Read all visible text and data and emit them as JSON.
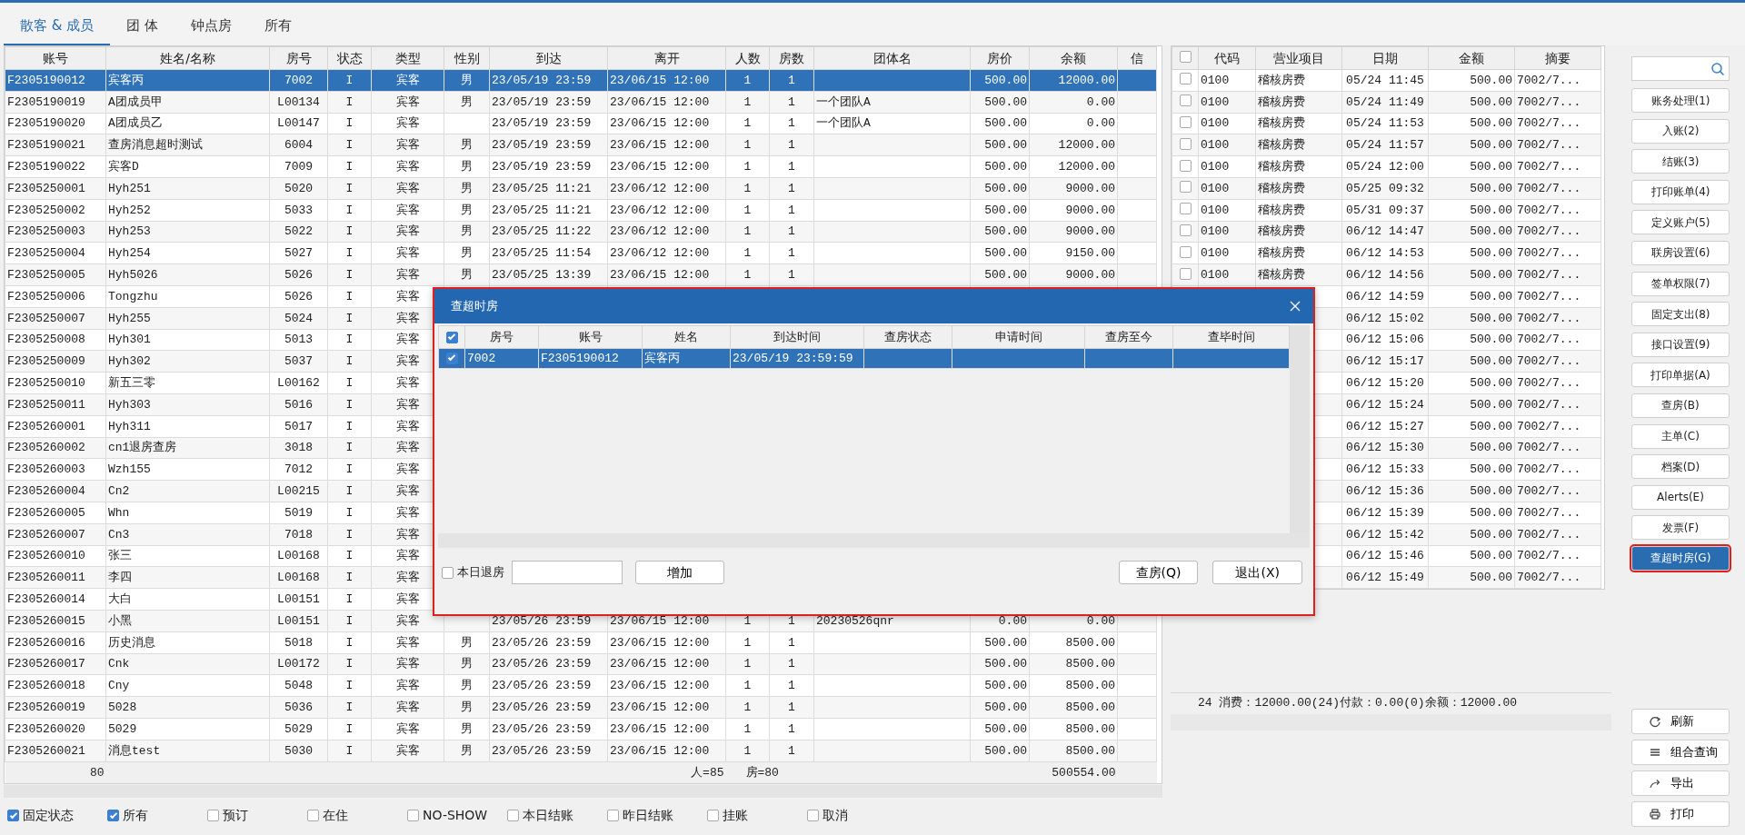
{
  "tabs": [
    {
      "label": "散客 & 成员",
      "selected": true
    },
    {
      "label": "团 体",
      "selected": false
    },
    {
      "label": "钟点房",
      "selected": false
    },
    {
      "label": "所有",
      "selected": false
    }
  ],
  "guest_table": {
    "columns": [
      "账号",
      "姓名/名称",
      "房号",
      "状态",
      "类型",
      "性别",
      "到达",
      "离开",
      "人数",
      "房数",
      "团体名",
      "房价",
      "余额",
      "信"
    ],
    "rows": [
      {
        "selected": true,
        "account": "F2305190012",
        "name": "宾客丙",
        "room": "7002",
        "status": "I",
        "type": "宾客",
        "sex": "男",
        "arrive": "23/05/19 23:59",
        "depart": "23/06/15 12:00",
        "people": "1",
        "rooms": "1",
        "rate": "500.00",
        "balance": "12000.00"
      },
      {
        "selected": false,
        "account": "F2305190019",
        "name": "A团成员甲",
        "room": "L00134",
        "status": "I",
        "type": "宾客",
        "sex": "男",
        "arrive": "23/05/19 23:59",
        "depart": "23/06/15 12:00",
        "people": "1",
        "rooms": "1",
        "group": "一个团队A",
        "rate": "500.00",
        "balance": "0.00"
      },
      {
        "selected": false,
        "account": "F2305190020",
        "name": "A团成员乙",
        "room": "L00147",
        "status": "I",
        "type": "宾客",
        "arrive": "23/05/19 23:59",
        "depart": "23/06/15 12:00",
        "people": "1",
        "rooms": "1",
        "group": "一个团队A",
        "rate": "500.00",
        "balance": "0.00"
      },
      {
        "selected": false,
        "account": "F2305190021",
        "name": "查房消息超时测试",
        "room": "6004",
        "status": "I",
        "type": "宾客",
        "sex": "男",
        "arrive": "23/05/19 23:59",
        "depart": "23/06/15 12:00",
        "people": "1",
        "rooms": "1",
        "rate": "500.00",
        "balance": "12000.00"
      },
      {
        "selected": false,
        "account": "F2305190022",
        "name": "宾客D",
        "room": "7009",
        "status": "I",
        "type": "宾客",
        "sex": "男",
        "arrive": "23/05/19 23:59",
        "depart": "23/06/15 12:00",
        "people": "1",
        "rooms": "1",
        "rate": "500.00",
        "balance": "12000.00"
      },
      {
        "selected": false,
        "account": "F2305250001",
        "name": "Hyh251",
        "room": "5020",
        "status": "I",
        "type": "宾客",
        "sex": "男",
        "arrive": "23/05/25 11:21",
        "depart": "23/06/12 12:00",
        "people": "1",
        "rooms": "1",
        "rate": "500.00",
        "balance": "9000.00"
      },
      {
        "selected": false,
        "account": "F2305250002",
        "name": "Hyh252",
        "room": "5033",
        "status": "I",
        "type": "宾客",
        "sex": "男",
        "arrive": "23/05/25 11:21",
        "depart": "23/06/12 12:00",
        "people": "1",
        "rooms": "1",
        "rate": "500.00",
        "balance": "9000.00"
      },
      {
        "selected": false,
        "account": "F2305250003",
        "name": "Hyh253",
        "room": "5022",
        "status": "I",
        "type": "宾客",
        "sex": "男",
        "arrive": "23/05/25 11:22",
        "depart": "23/06/12 12:00",
        "people": "1",
        "rooms": "1",
        "rate": "500.00",
        "balance": "9000.00"
      },
      {
        "selected": false,
        "account": "F2305250004",
        "name": "Hyh254",
        "room": "5027",
        "status": "I",
        "type": "宾客",
        "sex": "男",
        "arrive": "23/05/25 11:54",
        "depart": "23/06/12 12:00",
        "people": "1",
        "rooms": "1",
        "rate": "500.00",
        "balance": "9150.00"
      },
      {
        "selected": false,
        "account": "F2305250005",
        "name": "Hyh5026",
        "room": "5026",
        "status": "I",
        "type": "宾客",
        "sex": "男",
        "arrive": "23/05/25 13:39",
        "depart": "23/06/15 12:00",
        "people": "1",
        "rooms": "1",
        "rate": "500.00",
        "balance": "9000.00"
      },
      {
        "selected": false,
        "account": "F2305250006",
        "name": "Tongzhu",
        "room": "5026",
        "status": "I",
        "type": "宾客"
      },
      {
        "selected": false,
        "account": "F2305250007",
        "name": "Hyh255",
        "room": "5024",
        "status": "I",
        "type": "宾客"
      },
      {
        "selected": false,
        "account": "F2305250008",
        "name": "Hyh301",
        "room": "5013",
        "status": "I",
        "type": "宾客"
      },
      {
        "selected": false,
        "account": "F2305250009",
        "name": "Hyh302",
        "room": "5037",
        "status": "I",
        "type": "宾客"
      },
      {
        "selected": false,
        "account": "F2305250010",
        "name": "新五三零",
        "room": "L00162",
        "status": "I",
        "type": "宾客"
      },
      {
        "selected": false,
        "account": "F2305250011",
        "name": "Hyh303",
        "room": "5016",
        "status": "I",
        "type": "宾客"
      },
      {
        "selected": false,
        "account": "F2305260001",
        "name": "Hyh311",
        "room": "5017",
        "status": "I",
        "type": "宾客"
      },
      {
        "selected": false,
        "account": "F2305260002",
        "name": "cn1退房查房",
        "room": "3018",
        "status": "I",
        "type": "宾客"
      },
      {
        "selected": false,
        "account": "F2305260003",
        "name": "Wzh155",
        "room": "7012",
        "status": "I",
        "type": "宾客"
      },
      {
        "selected": false,
        "account": "F2305260004",
        "name": "Cn2",
        "room": "L00215",
        "status": "I",
        "type": "宾客"
      },
      {
        "selected": false,
        "account": "F2305260005",
        "name": "Whn",
        "room": "5019",
        "status": "I",
        "type": "宾客"
      },
      {
        "selected": false,
        "account": "F2305260007",
        "name": "Cn3",
        "room": "7018",
        "status": "I",
        "type": "宾客"
      },
      {
        "selected": false,
        "account": "F2305260010",
        "name": "张三",
        "room": "L00168",
        "status": "I",
        "type": "宾客"
      },
      {
        "selected": false,
        "account": "F2305260011",
        "name": "李四",
        "room": "L00168",
        "status": "I",
        "type": "宾客"
      },
      {
        "selected": false,
        "account": "F2305260014",
        "name": "大白",
        "room": "L00151",
        "status": "I",
        "type": "宾客"
      },
      {
        "selected": false,
        "account": "F2305260015",
        "name": "小黑",
        "room": "L00151",
        "status": "I",
        "type": "宾客",
        "arrive": "23/05/26 23:59",
        "depart": "23/06/15 12:00",
        "people": "1",
        "rooms": "1",
        "group": "20230526qnr",
        "rate": "0.00",
        "balance": "0.00"
      },
      {
        "selected": false,
        "account": "F2305260016",
        "name": "历史消息",
        "room": "5018",
        "status": "I",
        "type": "宾客",
        "sex": "男",
        "arrive": "23/05/26 23:59",
        "depart": "23/06/15 12:00",
        "people": "1",
        "rooms": "1",
        "rate": "500.00",
        "balance": "8500.00"
      },
      {
        "selected": false,
        "account": "F2305260017",
        "name": "Cnk",
        "room": "L00172",
        "status": "I",
        "type": "宾客",
        "sex": "男",
        "arrive": "23/05/26 23:59",
        "depart": "23/06/15 12:00",
        "people": "1",
        "rooms": "1",
        "rate": "500.00",
        "balance": "8500.00"
      },
      {
        "selected": false,
        "account": "F2305260018",
        "name": "Cny",
        "room": "5048",
        "status": "I",
        "type": "宾客",
        "sex": "男",
        "arrive": "23/05/26 23:59",
        "depart": "23/06/15 12:00",
        "people": "1",
        "rooms": "1",
        "rate": "500.00",
        "balance": "8500.00"
      },
      {
        "selected": false,
        "account": "F2305260019",
        "name": "5028",
        "room": "5036",
        "status": "I",
        "type": "宾客",
        "sex": "男",
        "arrive": "23/05/26 23:59",
        "depart": "23/06/15 12:00",
        "people": "1",
        "rooms": "1",
        "rate": "500.00",
        "balance": "8500.00"
      },
      {
        "selected": false,
        "account": "F2305260020",
        "name": "5029",
        "room": "5029",
        "status": "I",
        "type": "宾客",
        "sex": "男",
        "arrive": "23/05/26 23:59",
        "depart": "23/06/15 12:00",
        "people": "1",
        "rooms": "1",
        "rate": "500.00",
        "balance": "8500.00"
      },
      {
        "selected": false,
        "account": "F2305260021",
        "name": "消息test",
        "room": "5030",
        "status": "I",
        "type": "宾客",
        "sex": "男",
        "arrive": "23/05/26 23:59",
        "depart": "23/06/15 12:00",
        "people": "1",
        "rooms": "1",
        "rate": "500.00",
        "balance": "8500.00"
      }
    ],
    "footer": {
      "count": "80",
      "people": "人=85",
      "rooms": "房=80",
      "balance": "500554.00"
    }
  },
  "filters": [
    {
      "label": "固定状态",
      "checked": true
    },
    {
      "label": "所有",
      "checked": true
    },
    {
      "label": "预订",
      "checked": false
    },
    {
      "label": "在住",
      "checked": false
    },
    {
      "label": "NO-SHOW",
      "checked": false
    },
    {
      "label": "本日结账",
      "checked": false
    },
    {
      "label": "昨日结账",
      "checked": false
    },
    {
      "label": "挂账",
      "checked": false
    },
    {
      "label": "取消",
      "checked": false
    }
  ],
  "folio_table": {
    "select_all": {
      "checked": false
    },
    "columns": [
      "代码",
      "营业项目",
      "日期",
      "金额",
      "摘要"
    ],
    "rows": [
      {
        "checked": false,
        "code": "0100",
        "item": "稽核房费",
        "date": "05/24 11:45",
        "amount": "500.00",
        "memo": "7002/7..."
      },
      {
        "checked": false,
        "code": "0100",
        "item": "稽核房费",
        "date": "05/24 11:49",
        "amount": "500.00",
        "memo": "7002/7..."
      },
      {
        "checked": false,
        "code": "0100",
        "item": "稽核房费",
        "date": "05/24 11:53",
        "amount": "500.00",
        "memo": "7002/7..."
      },
      {
        "checked": false,
        "code": "0100",
        "item": "稽核房费",
        "date": "05/24 11:57",
        "amount": "500.00",
        "memo": "7002/7..."
      },
      {
        "checked": false,
        "code": "0100",
        "item": "稽核房费",
        "date": "05/24 12:00",
        "amount": "500.00",
        "memo": "7002/7..."
      },
      {
        "checked": false,
        "code": "0100",
        "item": "稽核房费",
        "date": "05/25 09:32",
        "amount": "500.00",
        "memo": "7002/7..."
      },
      {
        "checked": false,
        "code": "0100",
        "item": "稽核房费",
        "date": "05/31 09:37",
        "amount": "500.00",
        "memo": "7002/7..."
      },
      {
        "checked": false,
        "code": "0100",
        "item": "稽核房费",
        "date": "06/12 14:47",
        "amount": "500.00",
        "memo": "7002/7..."
      },
      {
        "checked": false,
        "code": "0100",
        "item": "稽核房费",
        "date": "06/12 14:53",
        "amount": "500.00",
        "memo": "7002/7..."
      },
      {
        "checked": false,
        "code": "0100",
        "item": "稽核房费",
        "date": "06/12 14:56",
        "amount": "500.00",
        "memo": "7002/7..."
      },
      {
        "date": "06/12 14:59",
        "amount": "500.00",
        "memo": "7002/7..."
      },
      {
        "date": "06/12 15:02",
        "amount": "500.00",
        "memo": "7002/7..."
      },
      {
        "date": "06/12 15:06",
        "amount": "500.00",
        "memo": "7002/7..."
      },
      {
        "date": "06/12 15:17",
        "amount": "500.00",
        "memo": "7002/7..."
      },
      {
        "date": "06/12 15:20",
        "amount": "500.00",
        "memo": "7002/7..."
      },
      {
        "date": "06/12 15:24",
        "amount": "500.00",
        "memo": "7002/7..."
      },
      {
        "date": "06/12 15:27",
        "amount": "500.00",
        "memo": "7002/7..."
      },
      {
        "date": "06/12 15:30",
        "amount": "500.00",
        "memo": "7002/7..."
      },
      {
        "date": "06/12 15:33",
        "amount": "500.00",
        "memo": "7002/7..."
      },
      {
        "date": "06/12 15:36",
        "amount": "500.00",
        "memo": "7002/7..."
      },
      {
        "date": "06/12 15:39",
        "amount": "500.00",
        "memo": "7002/7..."
      },
      {
        "date": "06/12 15:42",
        "amount": "500.00",
        "memo": "7002/7..."
      },
      {
        "date": "06/12 15:46",
        "amount": "500.00",
        "memo": "7002/7..."
      },
      {
        "date": "06/12 15:49",
        "amount": "500.00",
        "memo": "7002/7..."
      }
    ],
    "summary": "24 消费：12000.00(24)付款：0.00(0)余额：12000.00"
  },
  "actions": {
    "buttons": [
      {
        "label": "账务处理(1)",
        "selected": false
      },
      {
        "label": "入账(2)",
        "selected": false
      },
      {
        "label": "结账(3)",
        "selected": false
      },
      {
        "label": "打印账单(4)",
        "selected": false
      },
      {
        "label": "定义账户(5)",
        "selected": false
      },
      {
        "label": "联房设置(6)",
        "selected": false
      },
      {
        "label": "签单权限(7)",
        "selected": false
      },
      {
        "label": "固定支出(8)",
        "selected": false
      },
      {
        "label": "接口设置(9)",
        "selected": false
      },
      {
        "label": "打印单据(A)",
        "selected": false
      },
      {
        "label": "查房(B)",
        "selected": false
      },
      {
        "label": "主单(C)",
        "selected": false
      },
      {
        "label": "档案(D)",
        "selected": false
      },
      {
        "label": "Alerts(E)",
        "selected": false
      },
      {
        "label": "发票(F)",
        "selected": false
      },
      {
        "label": "查超时房(G)",
        "selected": true
      }
    ],
    "tools": [
      {
        "label": "刷新",
        "kind": "refresh"
      },
      {
        "label": "组合查询",
        "kind": "menu"
      },
      {
        "label": "导出",
        "kind": "export"
      },
      {
        "label": "打印",
        "kind": "print"
      }
    ]
  },
  "dialog": {
    "title": "查超时房",
    "select_all": {
      "checked": true
    },
    "columns": [
      "房号",
      "账号",
      "姓名",
      "到达时间",
      "查房状态",
      "申请时间",
      "查房至今",
      "查毕时间"
    ],
    "rows": [
      {
        "selected": true,
        "checked": true,
        "cells": [
          "7002",
          "F2305190012",
          "宾客丙",
          "23/05/19 23:59:59"
        ]
      }
    ],
    "checkout_today": {
      "label": "本日退房",
      "checked": false
    },
    "add_button": "增加",
    "check_button": "查房(Q)",
    "exit_button": "退出(X)"
  }
}
